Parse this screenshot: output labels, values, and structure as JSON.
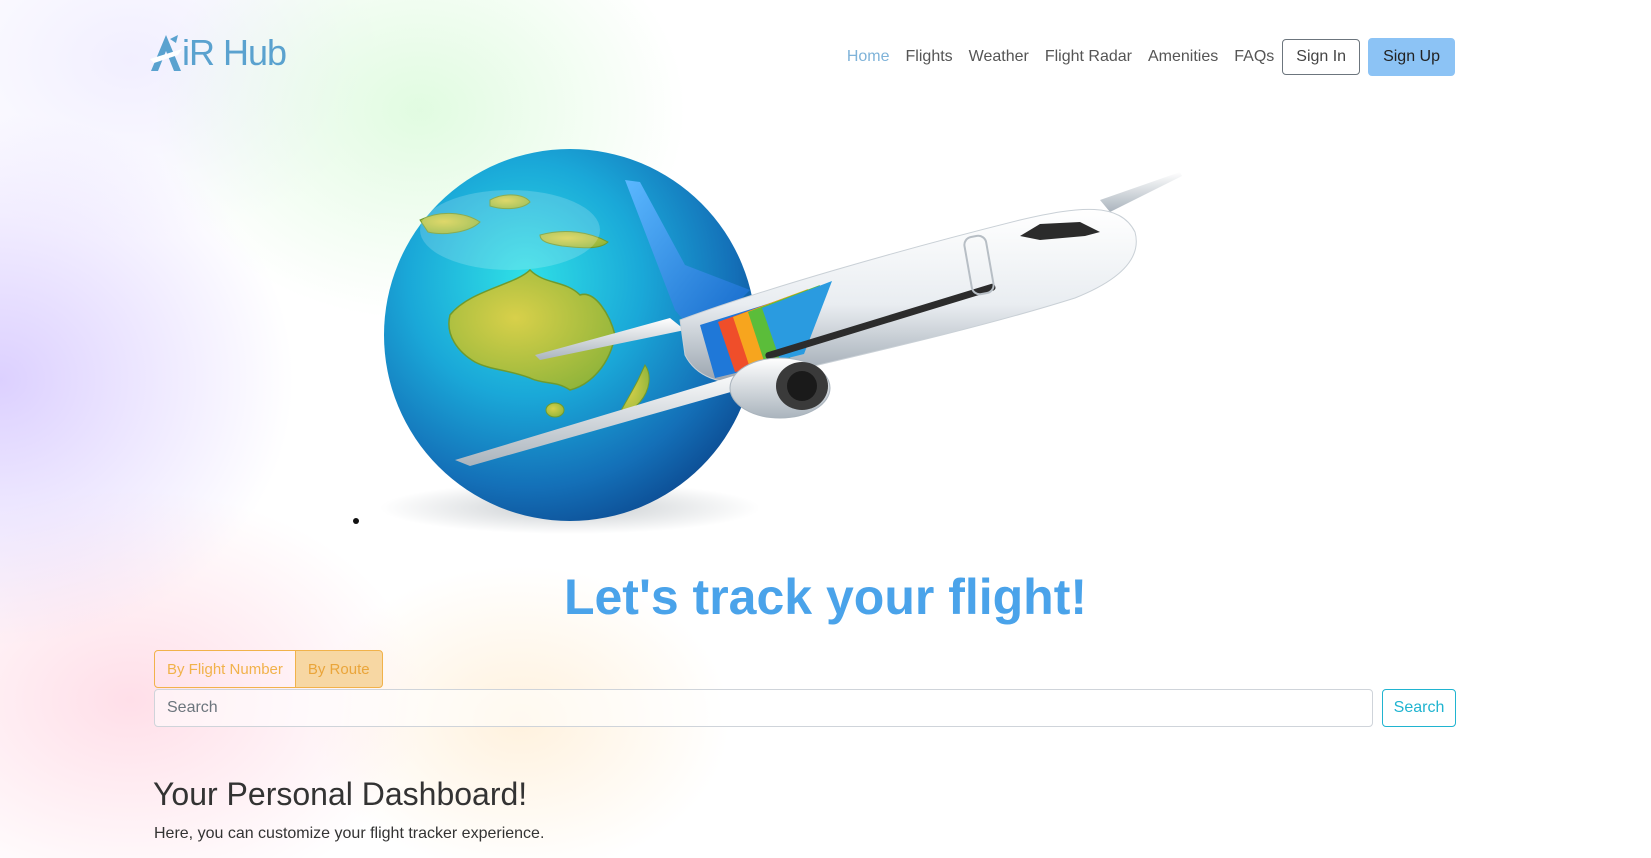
{
  "brand": {
    "logo_text": "iR Hub",
    "logo_color": "#5aa2cf"
  },
  "nav": {
    "items": [
      {
        "label": "Home",
        "active": true
      },
      {
        "label": "Flights",
        "active": false
      },
      {
        "label": "Weather",
        "active": false
      },
      {
        "label": "Flight Radar",
        "active": false
      },
      {
        "label": "Amenities",
        "active": false
      },
      {
        "label": "FAQs",
        "active": false
      }
    ],
    "sign_in_label": "Sign In",
    "sign_up_label": "Sign Up"
  },
  "hero": {
    "image": "globe-with-airplane",
    "headline": "Let's track your flight!",
    "headline_color": "#4aa3ea"
  },
  "search": {
    "modes": [
      "By Flight Number",
      "By Route"
    ],
    "selected_mode": "By Route",
    "placeholder": "Search",
    "value": "",
    "button_label": "Search",
    "accent_color": "#f1b24a",
    "button_color": "#20b4d0"
  },
  "dashboard": {
    "title": "Your Personal Dashboard!",
    "subtitle": "Here, you can customize your flight tracker experience."
  }
}
